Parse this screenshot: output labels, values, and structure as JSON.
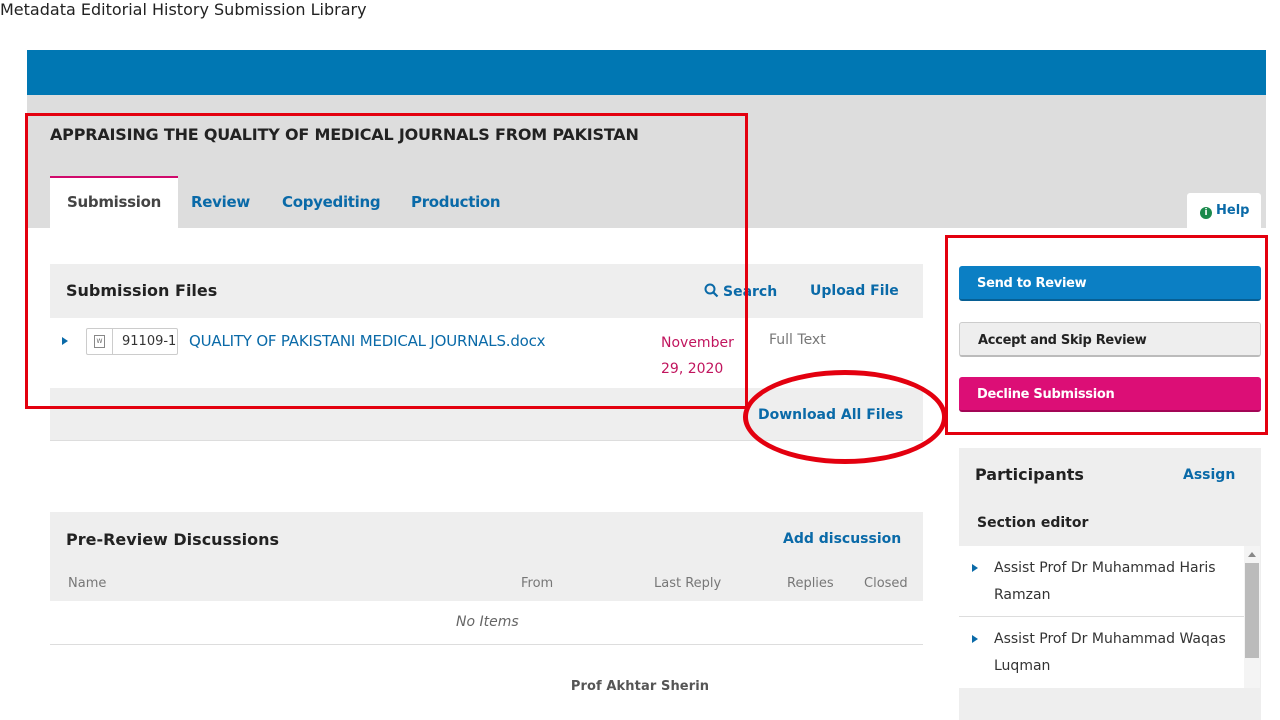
{
  "topnav": {
    "metadata": "Metadata",
    "editorial_history": "Editorial History",
    "submission_library": "Submission Library"
  },
  "submission": {
    "title": "APPRAISING THE QUALITY OF MEDICAL JOURNALS FROM PAKISTAN"
  },
  "tabs": [
    {
      "label": "Submission",
      "active": true
    },
    {
      "label": "Review",
      "active": false
    },
    {
      "label": "Copyediting",
      "active": false
    },
    {
      "label": "Production",
      "active": false
    }
  ],
  "help": {
    "label": "Help",
    "icon": "info-icon"
  },
  "files_panel": {
    "title": "Submission Files",
    "search_label": "Search",
    "upload_label": "Upload File",
    "download_all_label": "Download All Files",
    "files": [
      {
        "id": "91109-1",
        "name": "QUALITY OF PAKISTANI MEDICAL JOURNALS.docx",
        "date": "November 29, 2020",
        "type": "Full Text"
      }
    ]
  },
  "discussions_panel": {
    "title": "Pre-Review Discussions",
    "add_label": "Add discussion",
    "columns": [
      "Name",
      "From",
      "Last Reply",
      "Replies",
      "Closed"
    ],
    "empty_text": "No Items"
  },
  "actions": {
    "send_to_review": "Send to Review",
    "accept_skip": "Accept and Skip Review",
    "decline": "Decline Submission"
  },
  "participants": {
    "title": "Participants",
    "assign_label": "Assign",
    "group_label": "Section editor",
    "people": [
      "Assist Prof Dr Muhammad Haris Ramzan",
      "Assist Prof Dr Muhammad Waqas Luqman"
    ]
  },
  "footer": {
    "author": "Prof Akhtar Sherin"
  },
  "colors": {
    "header_blue": "#0077b3",
    "link_blue": "#0a6aa8",
    "primary": "#0b7fc4",
    "danger": "#dc0e76",
    "annotation_red": "#e3000f"
  }
}
